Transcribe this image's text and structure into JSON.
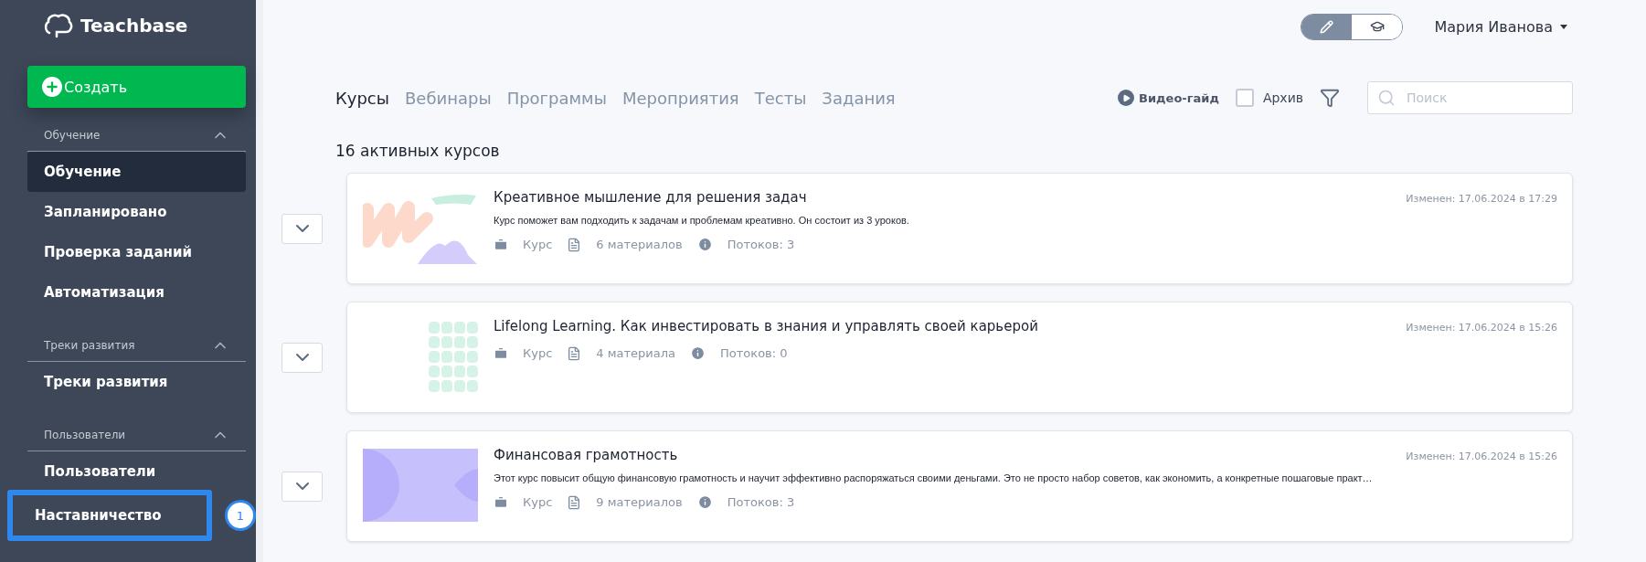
{
  "sidebar": {
    "logo": "Teachbase",
    "create_button": "Создать",
    "sections": [
      {
        "title": "Обучение",
        "expanded": true,
        "items": [
          {
            "label": "Обучение",
            "selected": true,
            "highlighted": false
          },
          {
            "label": "Запланировано",
            "selected": false,
            "highlighted": false
          },
          {
            "label": "Проверка заданий",
            "selected": false,
            "highlighted": false
          },
          {
            "label": "Автоматизация",
            "selected": false,
            "highlighted": false
          }
        ]
      },
      {
        "title": "Треки развития",
        "expanded": true,
        "items": [
          {
            "label": "Треки развития",
            "selected": false,
            "highlighted": false
          }
        ]
      },
      {
        "title": "Пользователи",
        "expanded": true,
        "items": [
          {
            "label": "Пользователи",
            "selected": false,
            "highlighted": false
          },
          {
            "label": "Наставничество",
            "selected": false,
            "highlighted": true,
            "badge": "1"
          }
        ]
      }
    ]
  },
  "header": {
    "modes": [
      {
        "kind": "edit",
        "selected": true
      },
      {
        "kind": "learn",
        "selected": false
      }
    ],
    "user": "Мария Иванова"
  },
  "tabs": [
    {
      "label": "Курсы",
      "selected": true
    },
    {
      "label": "Вебинары",
      "selected": false
    },
    {
      "label": "Программы",
      "selected": false
    },
    {
      "label": "Мероприятия",
      "selected": false
    },
    {
      "label": "Тесты",
      "selected": false
    },
    {
      "label": "Задания",
      "selected": false
    }
  ],
  "toolbar": {
    "video_guide": "Видео-гайд",
    "archive": {
      "label": "Архив",
      "checked": false
    },
    "search": {
      "placeholder": "Поиск"
    }
  },
  "count_heading": "16 активных курсов",
  "courses": [
    {
      "kind": "waves",
      "title": "Креативное мышление для решения задач",
      "description": "Курс поможет вам подходить к задачам и проблемам креативно. Он состоит из 3 уроков.",
      "type": "Курс",
      "materials": "6 материалов",
      "streams": "Потоков: 3",
      "modified": "Изменен: 17.06.2024 в 17:29"
    },
    {
      "kind": "grid",
      "title": "Lifelong Learning. Как инвестировать в знания и управлять своей карьерой",
      "type": "Курс",
      "materials": "4 материала",
      "streams": "Потоков: 0",
      "modified": "Изменен: 17.06.2024 в 15:26"
    },
    {
      "kind": "eye",
      "title": "Финансовая грамотность",
      "description": "Этот курс повысит общую финансовую грамотность и научит эффективно распоряжаться своими деньгами. Это не просто набор советов, как экономить, а конкретные пошаговые практ…",
      "type": "Курс",
      "materials": "9 материалов",
      "streams": "Потоков: 3",
      "modified": "Изменен: 17.06.2024 в 15:26"
    }
  ]
}
